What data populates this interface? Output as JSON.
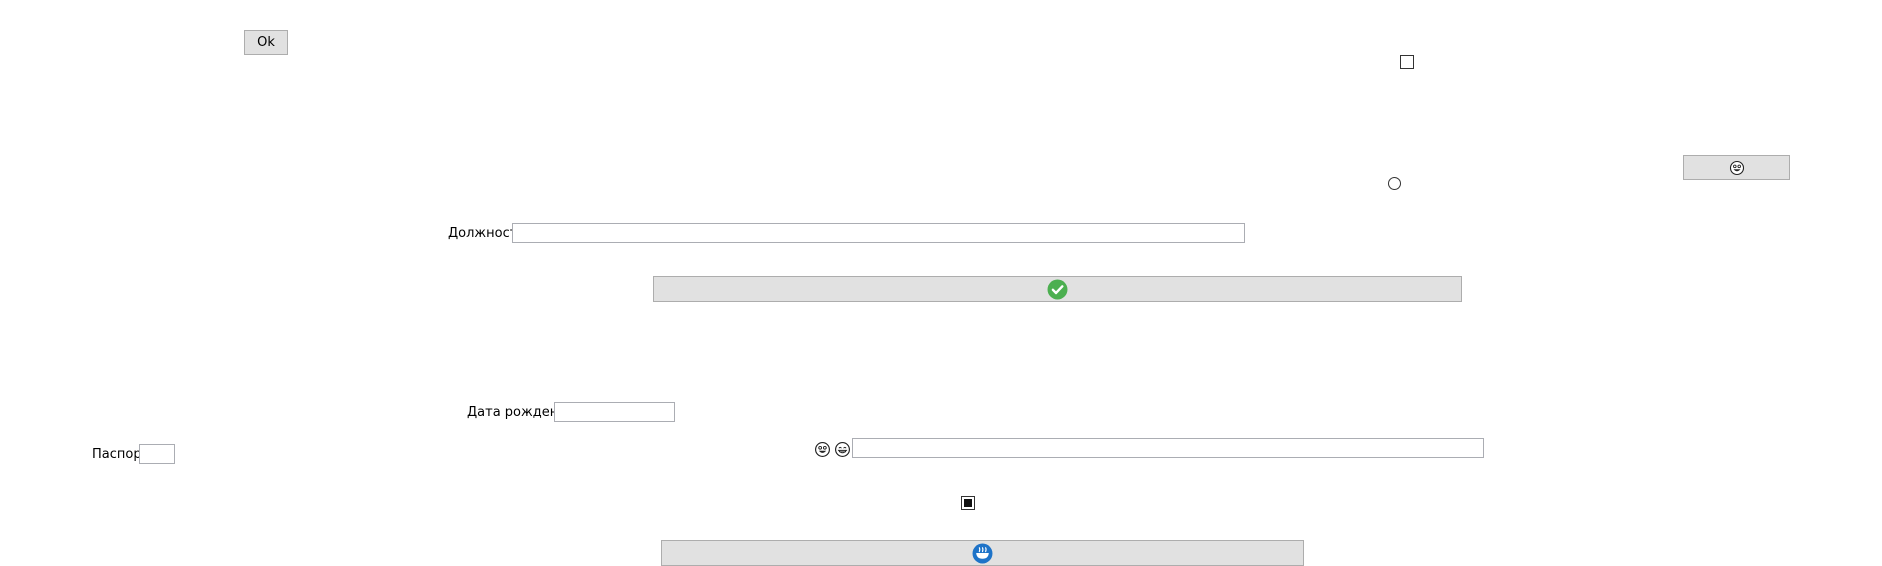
{
  "buttons": {
    "ok_label": "Ok"
  },
  "fields": {
    "position_label": "Должность",
    "position_value": "",
    "birthdate_label": "Дата рождения",
    "birthdate_value": "",
    "passport_label": "Паспорт",
    "passport_value": "",
    "emoji_text_value": ""
  },
  "icons": {
    "emoji_button": "smiling-face-icon",
    "confirm_button": "green-checkmark-icon",
    "bottom_button": "blue-bowl-icon",
    "field_prefix": [
      "smiling-face-icon",
      "grinning-face-icon"
    ]
  },
  "controls": {
    "top_checkbox_checked": false,
    "middle_checkbox_checked": true,
    "radio_selected": false
  },
  "colors": {
    "button_bg": "#e1e1e1",
    "check_green": "#4caf50",
    "bowl_blue": "#1e73c8"
  }
}
